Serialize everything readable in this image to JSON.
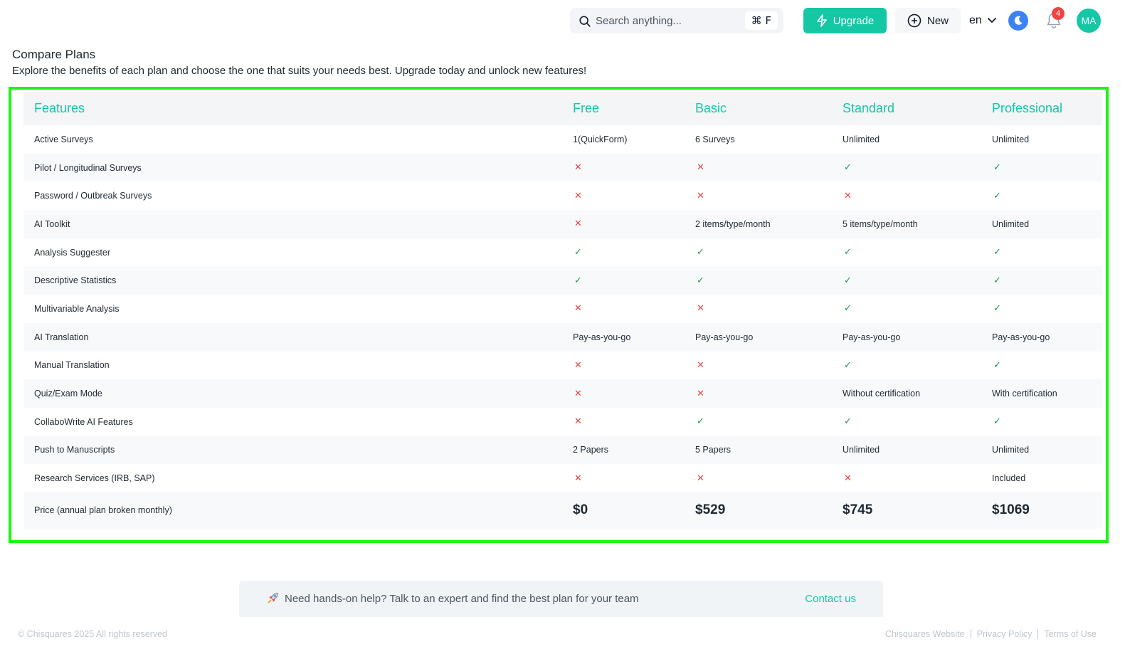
{
  "header": {
    "search_placeholder": "Search anything...",
    "search_shortcut": "⌘ F",
    "upgrade_label": "Upgrade",
    "new_label": "New",
    "language": "en",
    "notifications_count": "4",
    "avatar_initials": "MA",
    "accent_color": "#14c8a6"
  },
  "page": {
    "title": "Compare Plans",
    "subtitle": "Explore the benefits of each plan and choose the one that suits your needs best. Upgrade today and unlock new features!"
  },
  "table": {
    "columns": [
      "Features",
      "Free",
      "Basic",
      "Standard",
      "Professional"
    ],
    "rows": [
      {
        "feature": "Active Surveys",
        "values": [
          "1(QuickForm)",
          "6 Surveys",
          "Unlimited",
          "Unlimited"
        ]
      },
      {
        "feature": "Pilot / Longitudinal Surveys",
        "values": [
          "no",
          "no",
          "yes",
          "yes"
        ]
      },
      {
        "feature": "Password / Outbreak Surveys",
        "values": [
          "no",
          "no",
          "no",
          "yes"
        ]
      },
      {
        "feature": "AI Toolkit",
        "values": [
          "no",
          "2 items/type/month",
          "5 items/type/month",
          "Unlimited"
        ]
      },
      {
        "feature": "Analysis Suggester",
        "values": [
          "yes",
          "yes",
          "yes",
          "yes"
        ]
      },
      {
        "feature": "Descriptive Statistics",
        "values": [
          "yes",
          "yes",
          "yes",
          "yes"
        ]
      },
      {
        "feature": "Multivariable Analysis",
        "values": [
          "no",
          "no",
          "yes",
          "yes"
        ]
      },
      {
        "feature": "AI Translation",
        "values": [
          "Pay-as-you-go",
          "Pay-as-you-go",
          "Pay-as-you-go",
          "Pay-as-you-go"
        ]
      },
      {
        "feature": "Manual Translation",
        "values": [
          "no",
          "no",
          "yes",
          "yes"
        ]
      },
      {
        "feature": "Quiz/Exam Mode",
        "values": [
          "no",
          "no",
          "Without certification",
          "With certification"
        ]
      },
      {
        "feature": "CollaboWrite AI Features",
        "values": [
          "no",
          "yes",
          "yes",
          "yes"
        ]
      },
      {
        "feature": "Push to Manuscripts",
        "values": [
          "2 Papers",
          "5 Papers",
          "Unlimited",
          "Unlimited"
        ]
      },
      {
        "feature": "Research Services (IRB, SAP)",
        "values": [
          "no",
          "no",
          "no",
          "Included"
        ]
      }
    ],
    "price_row": {
      "feature": "Price (annual plan broken monthly)",
      "values": [
        "$0",
        "$529",
        "$745",
        "$1069"
      ]
    }
  },
  "help": {
    "message": "Need hands-on help? Talk to an expert and find the best plan for your team",
    "contact_label": "Contact us"
  },
  "footer": {
    "copyright": "© Chisquares 2025 All rights reserved",
    "links": [
      "Chisquares Website",
      "Privacy Policy",
      "Terms of Use"
    ]
  }
}
